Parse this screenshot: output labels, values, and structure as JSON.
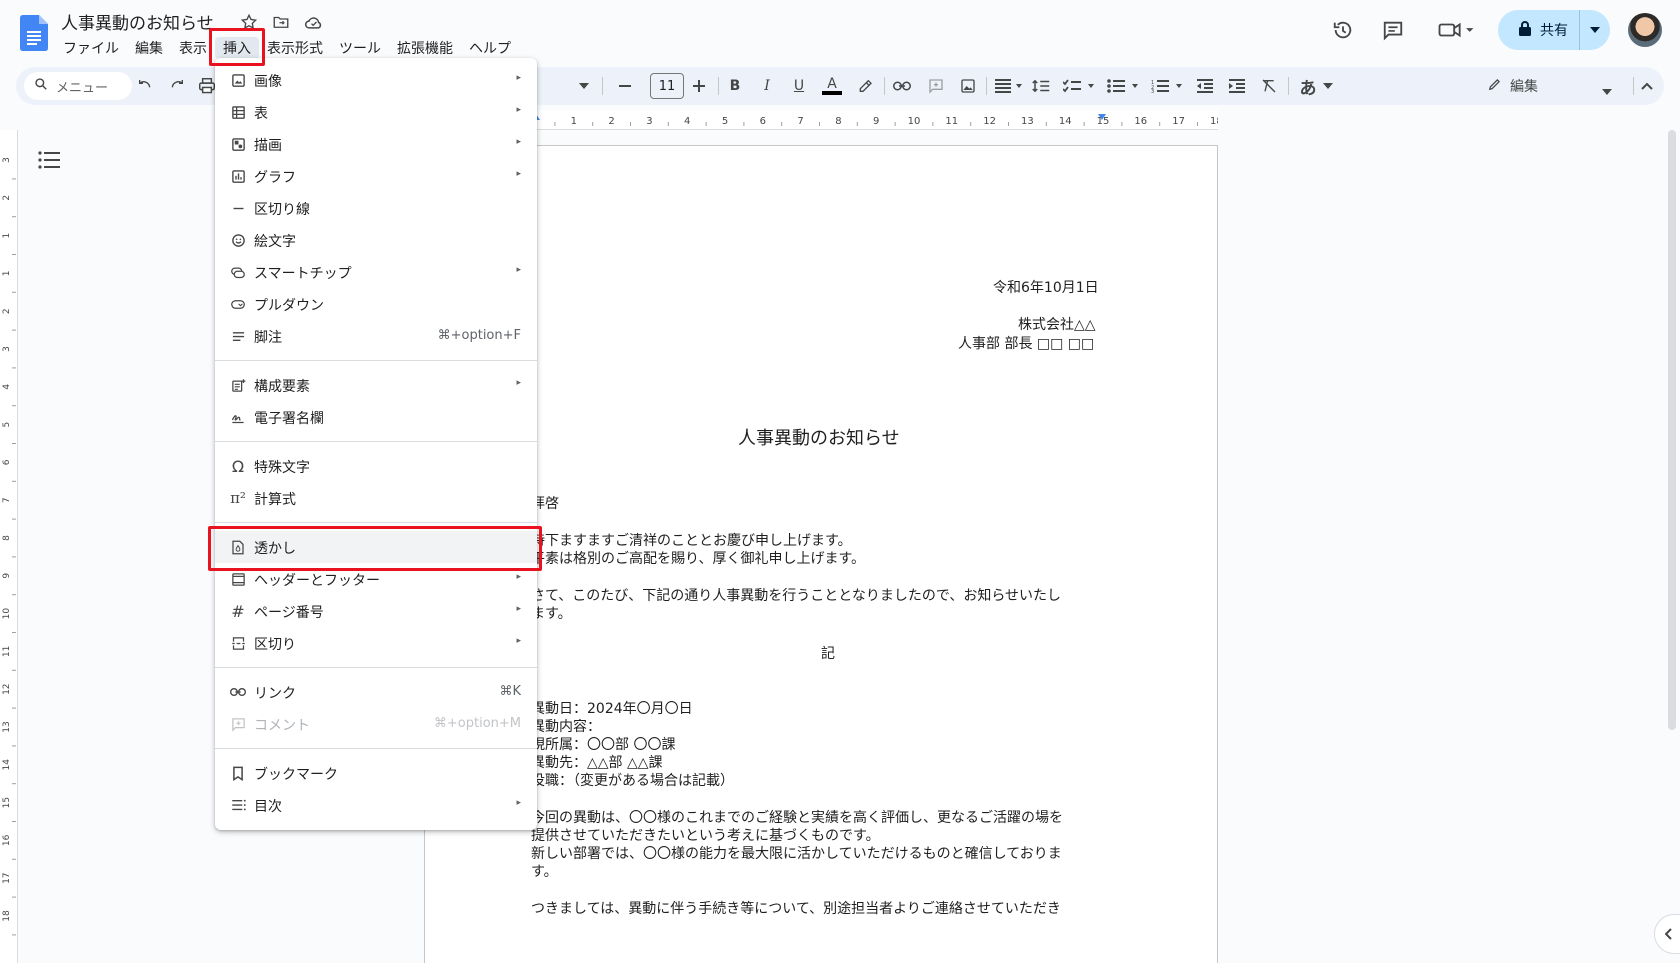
{
  "app": {
    "doc_title": "人事異動のお知らせ"
  },
  "menubar": [
    "ファイル",
    "編集",
    "表示",
    "挿入",
    "表示形式",
    "ツール",
    "拡張機能",
    "ヘルプ"
  ],
  "share": {
    "label": "共有"
  },
  "toolbar": {
    "search_placeholder": "メニュー",
    "font_size": "11",
    "edit_mode": "編集",
    "input_mode": "あ"
  },
  "insert_menu": {
    "items": [
      {
        "label": "画像",
        "icon": "image-icon",
        "submenu": true,
        "shortcut": ""
      },
      {
        "label": "表",
        "icon": "table-icon",
        "submenu": true,
        "shortcut": ""
      },
      {
        "label": "描画",
        "icon": "drawing-icon",
        "submenu": true,
        "shortcut": ""
      },
      {
        "label": "グラフ",
        "icon": "chart-icon",
        "submenu": true,
        "shortcut": ""
      },
      {
        "label": "区切り線",
        "icon": "horizontal-line-icon",
        "submenu": false,
        "shortcut": ""
      },
      {
        "label": "絵文字",
        "icon": "emoji-icon",
        "submenu": false,
        "shortcut": ""
      },
      {
        "label": "スマートチップ",
        "icon": "smart-chip-icon",
        "submenu": true,
        "shortcut": ""
      },
      {
        "label": "プルダウン",
        "icon": "dropdown-icon",
        "submenu": false,
        "shortcut": ""
      },
      {
        "label": "脚注",
        "icon": "footnote-icon",
        "submenu": false,
        "shortcut": "⌘+option+F"
      },
      {
        "label": "構成要素",
        "icon": "building-blocks-icon",
        "submenu": true,
        "shortcut": ""
      },
      {
        "label": "電子署名欄",
        "icon": "esignature-icon",
        "submenu": false,
        "shortcut": ""
      },
      {
        "label": "特殊文字",
        "icon": "omega-icon",
        "submenu": false,
        "shortcut": ""
      },
      {
        "label": "計算式",
        "icon": "equation-icon",
        "submenu": false,
        "shortcut": ""
      },
      {
        "label": "透かし",
        "icon": "watermark-icon",
        "submenu": false,
        "shortcut": ""
      },
      {
        "label": "ヘッダーとフッター",
        "icon": "header-footer-icon",
        "submenu": true,
        "shortcut": ""
      },
      {
        "label": "ページ番号",
        "icon": "hash-icon",
        "submenu": true,
        "shortcut": ""
      },
      {
        "label": "区切り",
        "icon": "break-icon",
        "submenu": true,
        "shortcut": ""
      },
      {
        "label": "リンク",
        "icon": "link-icon",
        "submenu": false,
        "shortcut": "⌘K"
      },
      {
        "label": "コメント",
        "icon": "comment-add-icon",
        "submenu": false,
        "shortcut": "⌘+option+M",
        "disabled": true
      },
      {
        "label": "ブックマーク",
        "icon": "bookmark-icon",
        "submenu": false,
        "shortcut": ""
      },
      {
        "label": "目次",
        "icon": "toc-icon",
        "submenu": true,
        "shortcut": ""
      }
    ]
  },
  "document": {
    "date": "令和6年10月1日",
    "company": "株式会社△△",
    "sender": "人事部 部長 □□ □□",
    "heading": "人事異動のお知らせ",
    "salutation": "拝啓",
    "para1_line1": "時下ますますご清祥のこととお慶び申し上げます。",
    "para1_line2": "平素は格別のご高配を賜り、厚く御礼申し上げます。",
    "para2_line1": "さて、このたび、下記の通り人事異動を行うこととなりましたので、お知らせいたし",
    "para2_line2": "ます。",
    "ki": "記",
    "detail1": "異動日：2024年〇月〇日",
    "detail2": "異動内容：",
    "detail3": "現所属：〇〇部 〇〇課",
    "detail4": "異動先：△△部 △△課",
    "detail5": "役職：（変更がある場合は記載）",
    "para3_line1": "今回の異動は、〇〇様のこれまでのご経験と実績を高く評価し、更なるご活躍の場を",
    "para3_line2": "提供させていただきたいという考えに基づくものです。",
    "para3_line3": "新しい部署では、〇〇様の能力を最大限に活かしていただけるものと確信しておりま",
    "para3_line4": "す。",
    "para4_line1": "つきましては、異動に伴う手続き等について、別途担当者よりご連絡させていただき"
  },
  "ruler": {
    "h_ticks": [
      "1",
      "2",
      "3",
      "4",
      "5",
      "6",
      "7",
      "8",
      "9",
      "10",
      "11",
      "12",
      "13",
      "14",
      "15",
      "16",
      "17",
      "18"
    ],
    "v_ticks": [
      "3",
      "2",
      "1",
      "1",
      "2",
      "3",
      "4",
      "5",
      "6",
      "7",
      "8",
      "9",
      "10",
      "11",
      "12",
      "13",
      "14",
      "15",
      "16",
      "17",
      "18"
    ]
  },
  "colors": {
    "accent": "#c2e7ff",
    "highlight": "#e8131f",
    "doc_blue": "#4285f4"
  }
}
